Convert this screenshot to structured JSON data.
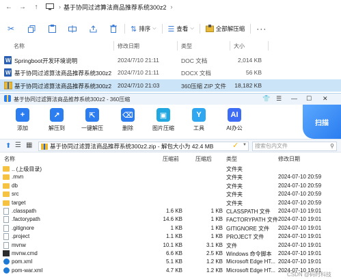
{
  "explorer": {
    "breadcrumb": "基于协同过滤算法商品推荐系统300z2",
    "commands": {
      "sort": "排序",
      "view": "查看",
      "extract_all": "全部解压缩"
    },
    "headers": {
      "name": "名称",
      "modified": "修改日期",
      "type": "类型",
      "size": "大小"
    },
    "files": [
      {
        "name": "Springboot开发环境说明",
        "modified": "2024/7/10 21:11",
        "type": "DOC 文档",
        "size": "2,014 KB",
        "icon": "word-doc-icon"
      },
      {
        "name": "基于协同过滤算法商品推荐系统300z2",
        "modified": "2024/7/10 21:11",
        "type": "DOCX 文档",
        "size": "56 KB",
        "icon": "word-docx-icon"
      },
      {
        "name": "基于协同过滤算法商品推荐系统300z2",
        "modified": "2024/7/10 21:03",
        "type": "360压缩 ZIP 文件",
        "size": "18,182 KB",
        "icon": "zip-icon",
        "selected": true
      }
    ]
  },
  "zip": {
    "title": "基于协同过滤算法商品推荐系统300z2 - 360压缩",
    "tools": [
      {
        "label": "添加",
        "icon": "add-icon",
        "color": "#2b7df0"
      },
      {
        "label": "解压到",
        "icon": "extract-to-icon",
        "color": "#2b7df0"
      },
      {
        "label": "一键解压",
        "icon": "one-click-extract-icon",
        "color": "#2b7df0"
      },
      {
        "label": "删除",
        "icon": "delete-icon",
        "color": "#2b7df0"
      },
      {
        "label": "图片压缩",
        "icon": "image-compress-icon",
        "color": "#22a7e0"
      },
      {
        "label": "工具",
        "icon": "tools-icon",
        "color": "#2fa6f0"
      },
      {
        "label": "AI办公",
        "icon": "ai-office-icon",
        "color": "#3d6cf5"
      }
    ],
    "scan_label": "扫描",
    "address": "基于协同过滤算法商品推荐系统300z2.zip - 解包大小为 42.4 MB",
    "search_placeholder": "搜索包内文件",
    "headers": {
      "name": "名称",
      "compressed": "压缩前",
      "packed": "压缩后",
      "type": "类型",
      "modified": "修改日期"
    },
    "rows": [
      {
        "name": ".. (上级目录)",
        "compressed": "",
        "packed": "",
        "type": "文件夹",
        "modified": "",
        "kind": "folder"
      },
      {
        "name": ".mvn",
        "compressed": "",
        "packed": "",
        "type": "文件夹",
        "modified": "2024-07-10 20:59",
        "kind": "folder"
      },
      {
        "name": "db",
        "compressed": "",
        "packed": "",
        "type": "文件夹",
        "modified": "2024-07-10 20:59",
        "kind": "folder"
      },
      {
        "name": "src",
        "compressed": "",
        "packed": "",
        "type": "文件夹",
        "modified": "2024-07-10 20:59",
        "kind": "folder"
      },
      {
        "name": "target",
        "compressed": "",
        "packed": "",
        "type": "文件夹",
        "modified": "2024-07-10 20:59",
        "kind": "folder"
      },
      {
        "name": ".classpath",
        "compressed": "1.6 KB",
        "packed": "1 KB",
        "type": "CLASSPATH 文件",
        "modified": "2024-07-10 19:01",
        "kind": "file"
      },
      {
        "name": ".factorypath",
        "compressed": "14.6 KB",
        "packed": "1 KB",
        "type": "FACTORYPATH 文件",
        "modified": "2024-07-10 19:01",
        "kind": "file"
      },
      {
        "name": ".gitignore",
        "compressed": "1 KB",
        "packed": "1 KB",
        "type": "GITIGNORE 文件",
        "modified": "2024-07-10 19:01",
        "kind": "file"
      },
      {
        "name": ".project",
        "compressed": "1.1 KB",
        "packed": "1 KB",
        "type": "PROJECT 文件",
        "modified": "2024-07-10 19:01",
        "kind": "file"
      },
      {
        "name": "mvnw",
        "compressed": "10.1 KB",
        "packed": "3.1 KB",
        "type": "文件",
        "modified": "2024-07-10 19:01",
        "kind": "file"
      },
      {
        "name": "mvnw.cmd",
        "compressed": "6.6 KB",
        "packed": "2.5 KB",
        "type": "Windows 命令脚本",
        "modified": "2024-07-10 19:01",
        "kind": "cmd"
      },
      {
        "name": "pom.xml",
        "compressed": "5.1 KB",
        "packed": "1.2 KB",
        "type": "Microsoft Edge HT...",
        "modified": "2024-07-10 19:01",
        "kind": "edge"
      },
      {
        "name": "pom-war.xml",
        "compressed": "4.7 KB",
        "packed": "1.2 KB",
        "type": "Microsoft Edge HT...",
        "modified": "2024-07-10 19:01",
        "kind": "edge"
      }
    ]
  },
  "watermark": "CSDN @码时科技"
}
